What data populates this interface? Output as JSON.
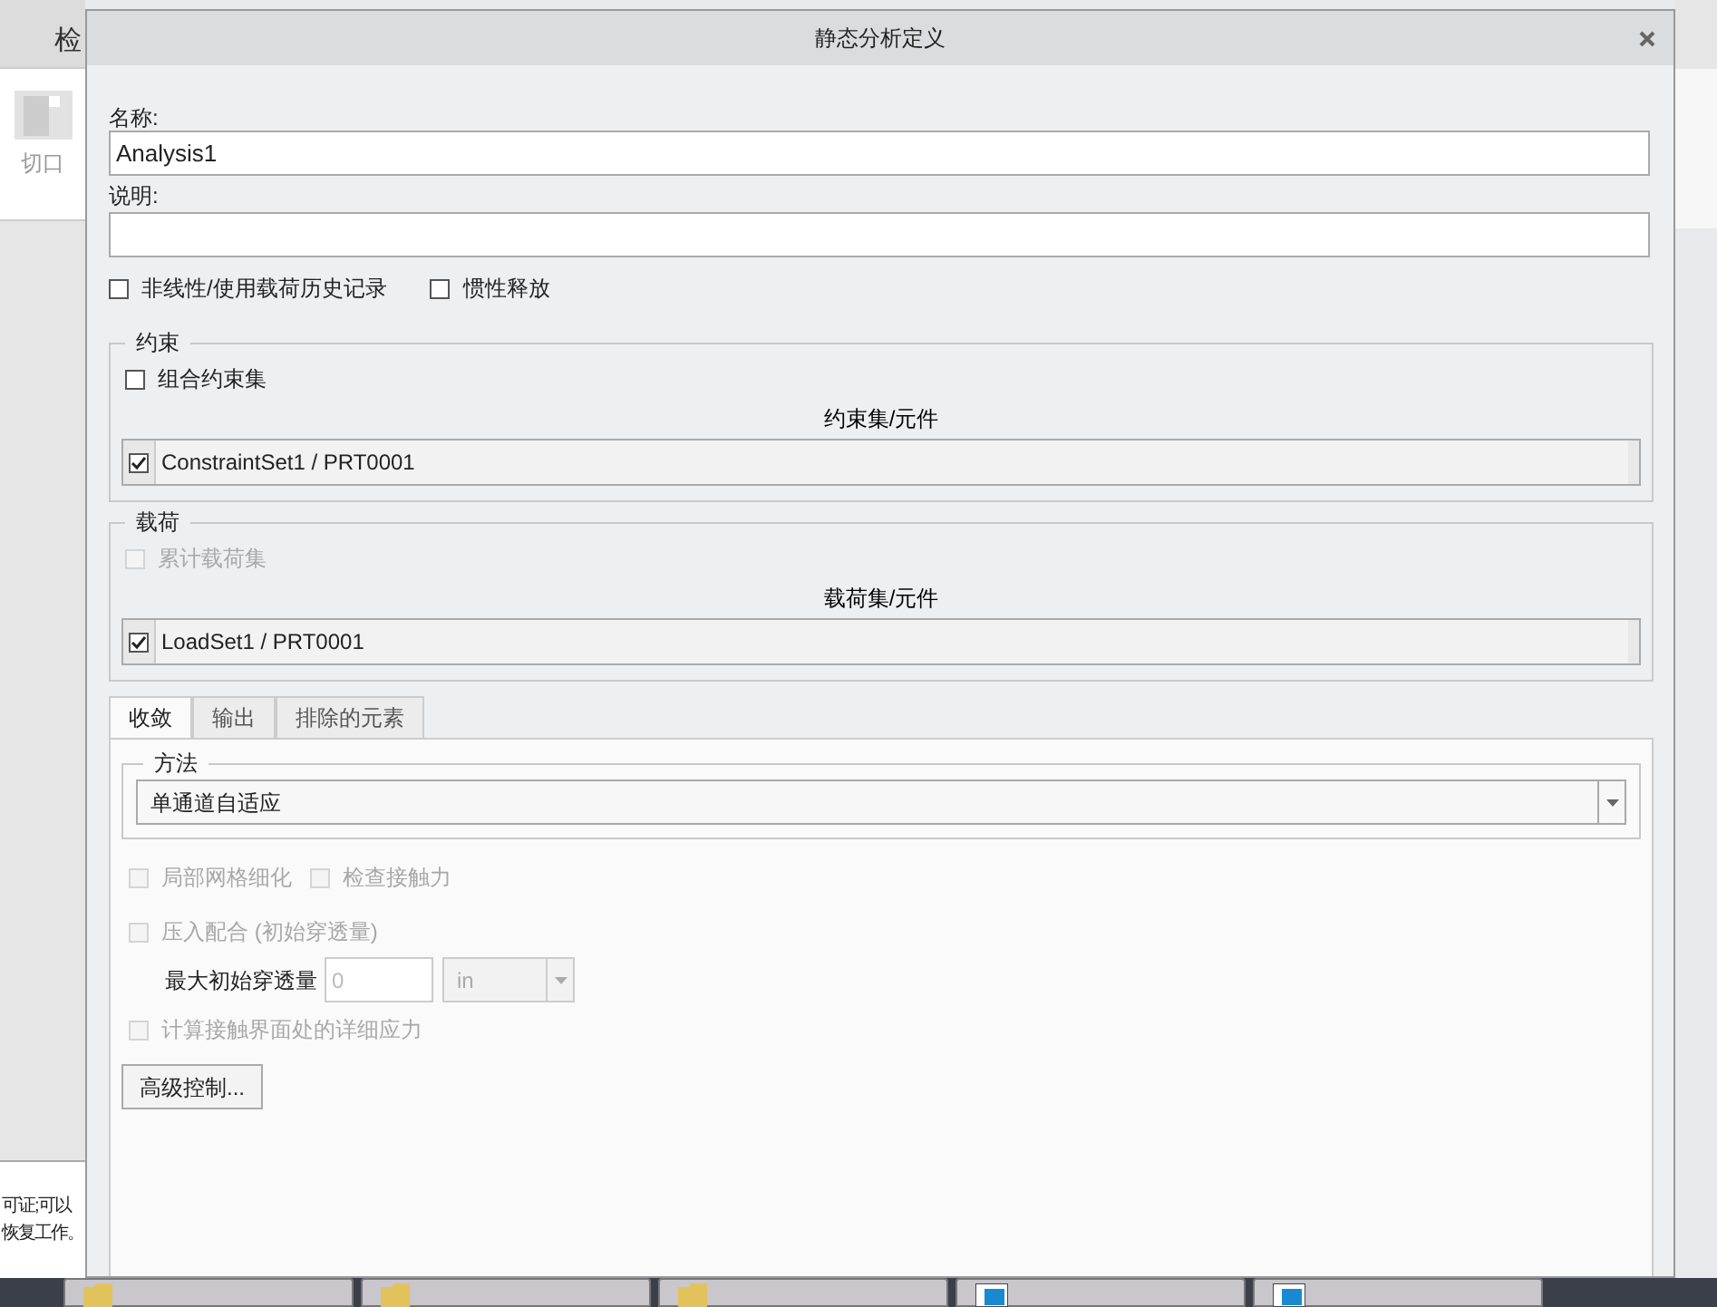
{
  "background_app": {
    "tab": "检",
    "ribbon_button": "切口",
    "message_lines": [
      "可证;可以",
      "恢复工作。"
    ]
  },
  "dialog": {
    "title": "静态分析定义"
  },
  "name_field": {
    "label": "名称:",
    "value": "Analysis1"
  },
  "description_field": {
    "label": "说明:"
  },
  "options": [
    {
      "label": "非线性/使用载荷历史记录",
      "checked": false
    },
    {
      "label": "惯性释放",
      "checked": false
    }
  ],
  "constraints": {
    "title": "约束",
    "combine": {
      "label": "组合约束集",
      "checked": false,
      "disabled": false
    },
    "list_header": "约束集/元件",
    "items": [
      {
        "label": "ConstraintSet1 / PRT0001",
        "checked": true
      }
    ]
  },
  "loads": {
    "title": "载荷",
    "combine": {
      "label": "累计载荷集",
      "checked": false,
      "disabled": true
    },
    "list_header": "载荷集/元件",
    "items": [
      {
        "label": "LoadSet1 / PRT0001",
        "checked": true
      }
    ]
  },
  "tabs": [
    {
      "label": "收敛",
      "selected": true
    },
    {
      "label": "输出",
      "selected": false
    },
    {
      "label": "排除的元素",
      "selected": false
    }
  ],
  "method": {
    "title": "方法",
    "value": "单通道自适应"
  },
  "convergence_row": [
    {
      "label": "局部网格细化",
      "checked": false,
      "disabled": true
    },
    {
      "label": "检查接触力",
      "checked": false,
      "disabled": true
    }
  ],
  "press_fit": {
    "label": "压入配合 (初始穿透量)",
    "checked": false,
    "disabled": true
  },
  "max_penetration": {
    "label": "最大初始穿透量",
    "value": "0",
    "unit": "in",
    "disabled": true
  },
  "detailed_stress": {
    "label": "计算接触界面处的详细应力",
    "checked": false,
    "disabled": true
  },
  "advanced_button": "高级控制...",
  "taskbar": {
    "items": [
      {
        "kind": "folder"
      },
      {
        "kind": "folder"
      },
      {
        "kind": "folder"
      },
      {
        "kind": "app"
      },
      {
        "kind": "app"
      }
    ]
  }
}
